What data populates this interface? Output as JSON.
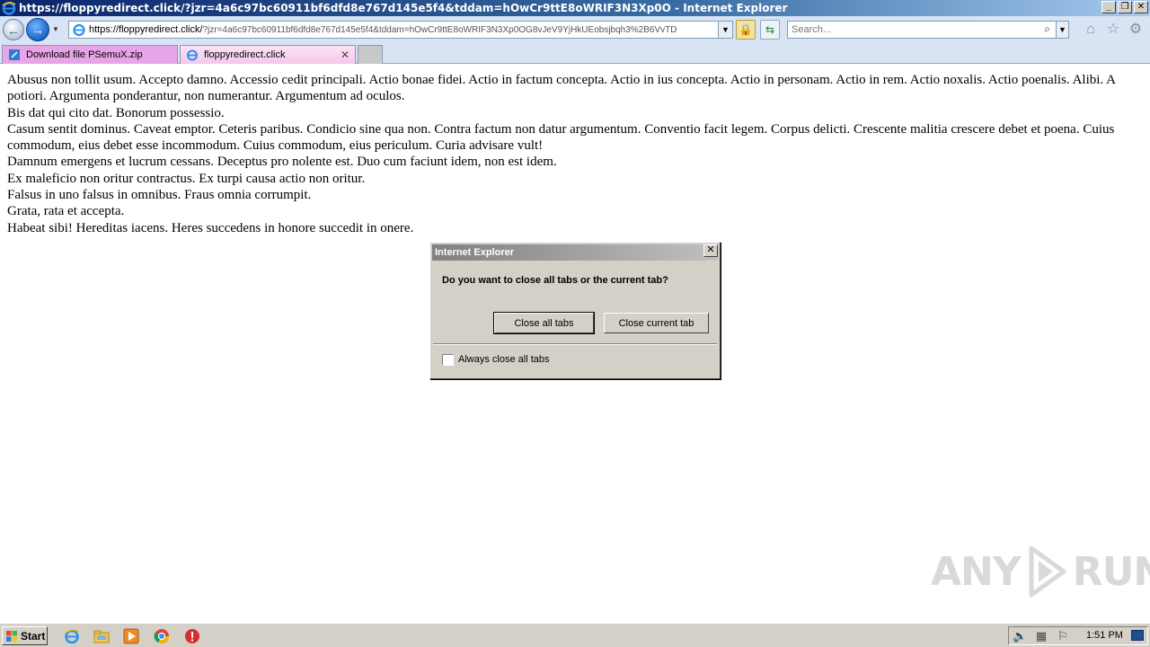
{
  "window": {
    "title": "https://floppyredirect.click/?jzr=4a6c97bc60911bf6dfd8e767d145e5f4&tddam=hOwCr9ttE8oWRIF3N3Xp0O - Internet Explorer",
    "minimize": "_",
    "restore": "❐",
    "close": "✕"
  },
  "nav": {
    "back_glyph": "←",
    "forward_glyph": "→",
    "address_host": "https://floppyredirect.click/",
    "address_rest": "?jzr=4a6c97bc60911bf6dfd8e767d145e5f4&tddam=hOwCr9ttE8oWRIF3N3Xp0OG8vJeV9YjHkUEobsjbqh3%2B6VvTD",
    "search_placeholder": "Search...",
    "icons": [
      "back-icon",
      "forward-icon",
      "lock-icon",
      "refresh-icon",
      "search-icon",
      "home-icon",
      "favorites-star-icon",
      "tools-gear-icon"
    ]
  },
  "tabs": [
    {
      "label": "Download file PSemuX.zip",
      "active": false,
      "color": "#e7a4e7"
    },
    {
      "label": "floppyredirect.click",
      "active": true,
      "close": "✕"
    },
    {
      "label": "",
      "new_tab": true
    }
  ],
  "content": {
    "paragraphs": [
      "Abusus non tollit usum. Accepto damno. Accessio cedit principali. Actio bonae fidei. Actio in factum concepta. Actio in ius concepta. Actio in personam. Actio in rem. Actio noxalis. Actio poenalis. Alibi. A potiori. Argumenta ponderantur, non numerantur. Argumentum ad oculos.",
      "Bis dat qui cito dat. Bonorum possessio.",
      "Casum sentit dominus. Caveat emptor. Ceteris paribus. Condicio sine qua non. Contra factum non datur argumentum. Conventio facit legem. Corpus delicti. Crescente malitia crescere debet et poena. Cuius commodum, eius debet esse incommodum. Cuius commodum, eius periculum. Curia advisare vult!",
      "Damnum emergens et lucrum cessans. Deceptus pro nolente est. Duo cum faciunt idem, non est idem.",
      "Ex maleficio non oritur contractus. Ex turpi causa actio non oritur.",
      "Falsus in uno falsus in omnibus. Fraus omnia corrumpit.",
      "Grata, rata et accepta.",
      "Habeat sibi! Hereditas iacens. Heres succedens in honore succedit in onere."
    ]
  },
  "dialog": {
    "title": "Internet Explorer",
    "close": "✕",
    "question": "Do you want to close all tabs or the current tab?",
    "btn_all": "Close all tabs",
    "btn_current": "Close current tab",
    "checkbox_label": "Always close all tabs",
    "checkbox_checked": false
  },
  "watermark": {
    "left": "ANY",
    "right": "RUN"
  },
  "taskbar": {
    "start": "Start",
    "clock": "1:51 PM",
    "icons": [
      "ie-icon",
      "explorer-folder-icon",
      "media-player-icon",
      "chrome-icon",
      "stop-icon"
    ],
    "tray_icons": [
      "volume-icon",
      "network-icon",
      "flag-icon"
    ]
  }
}
